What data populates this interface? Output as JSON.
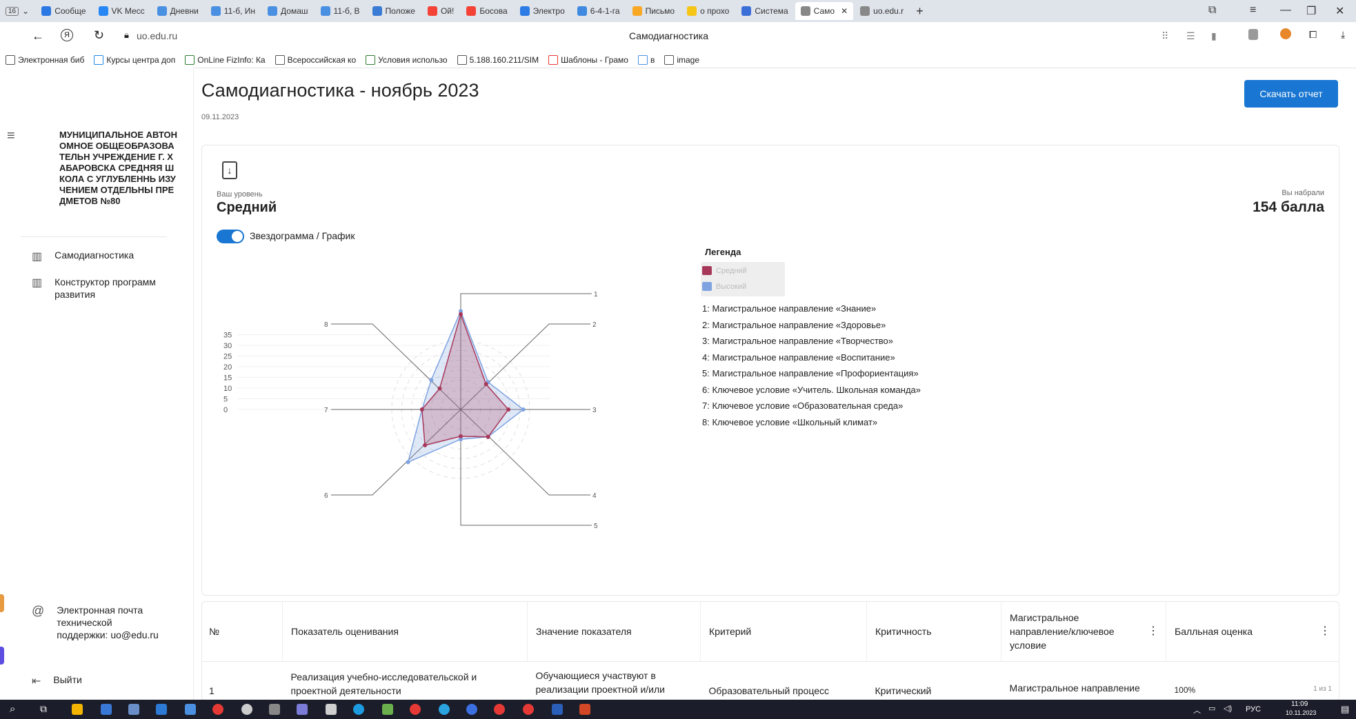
{
  "browser": {
    "tab_count": "16",
    "tabs": [
      {
        "label": "Сообще",
        "color": "#2b78e4"
      },
      {
        "label": "VK Месс",
        "color": "#2787f5"
      },
      {
        "label": "Дневни",
        "color": "#4a90e2"
      },
      {
        "label": "11-б, Ин",
        "color": "#4a90e2"
      },
      {
        "label": "Домаш",
        "color": "#4a90e2"
      },
      {
        "label": "11-б, В",
        "color": "#4a90e2"
      },
      {
        "label": "Положе",
        "color": "#3a7bd5"
      },
      {
        "label": "Ой!",
        "color": "#f44336"
      },
      {
        "label": "Босова",
        "color": "#f44336"
      },
      {
        "label": "Электро",
        "color": "#2d7be5"
      },
      {
        "label": "6-4-1-га",
        "color": "#3f8ae0"
      },
      {
        "label": "Письмо",
        "color": "#f9a825"
      },
      {
        "label": "о прохо",
        "color": "#f5c518"
      },
      {
        "label": "Система",
        "color": "#3a6fd8"
      },
      {
        "label": "Само",
        "color": "#888888",
        "active": true
      },
      {
        "label": "uo.edu.r",
        "color": "#888888"
      }
    ],
    "new_tab": "+",
    "url": "uo.edu.ru",
    "page_title": "Самодиагностика",
    "bookmarks": [
      {
        "label": "Электронная биб",
        "color": "#555555"
      },
      {
        "label": "Курсы центра доп",
        "color": "#1e88e5"
      },
      {
        "label": "OnLine FizInfo: Ка",
        "color": "#2e7d32"
      },
      {
        "label": "Всероссийская ко",
        "color": "#555555"
      },
      {
        "label": "Условия использо",
        "color": "#2e7d32"
      },
      {
        "label": "5.188.160.211/SIM",
        "color": "#555555"
      },
      {
        "label": "Шаблоны - Грамо",
        "color": "#e53935"
      },
      {
        "label": "в",
        "color": "#4a90e2"
      },
      {
        "label": "image",
        "color": "#555555"
      }
    ]
  },
  "sidebar": {
    "org_name": "МУНИЦИПАЛЬНОЕ АВТОНОМНОЕ ОБЩЕОБРАЗОВАТЕЛЬН УЧРЕЖДЕНИЕ Г. ХАБАРОВСКА СРЕДНЯЯ ШКОЛА С УГЛУБЛЕННЬ ИЗУЧЕНИЕМ ОТДЕЛЬНЫ ПРЕДМЕТОВ №80",
    "items": [
      {
        "label": "Самодиагностика"
      },
      {
        "label": "Конструктор программ развития"
      }
    ],
    "support": "Электронная почта технической поддержки: uo@edu.ru",
    "logout": "Выйти"
  },
  "header": {
    "title": "Самодиагностика - ноябрь 2023",
    "date": "09.11.2023",
    "download_button": "Скачать отчет"
  },
  "summary": {
    "level_caption": "Ваш уровень",
    "level": "Средний",
    "score_caption": "Вы набрали",
    "score": "154 балла",
    "toggle_label": "Звездограмма / График",
    "toggle_on": true
  },
  "legend": {
    "title": "Легенда",
    "series": [
      {
        "name": "Средний",
        "color": "#a8385a"
      },
      {
        "name": "Высокий",
        "color": "#7ea3e0"
      }
    ],
    "items": [
      "1: Магистральное направление «Знание»",
      "2: Магистральное направление «Здоровье»",
      "3: Магистральное направление «Творчество»",
      "4: Магистральное направление «Воспитание»",
      "5: Магистральное направление «Профориентация»",
      "6: Ключевое условие «Учитель. Школьная команда»",
      "7: Ключевое условие «Образовательная среда»",
      "8: Ключевое условие «Школьный климат»"
    ]
  },
  "chart_data": {
    "type": "radar",
    "categories": [
      "1",
      "2",
      "3",
      "4",
      "5",
      "6",
      "7",
      "8"
    ],
    "ticks": [
      "35",
      "30",
      "25",
      "20",
      "15",
      "10",
      "5",
      "0"
    ],
    "rmax": 35,
    "series": [
      {
        "name": "Средний",
        "color": "#a8385a",
        "values": [
          32,
          12,
          16,
          13,
          9,
          17,
          13,
          10
        ]
      },
      {
        "name": "Высокий",
        "color": "#7ea3e0",
        "values": [
          33,
          13,
          21,
          13,
          10,
          25,
          13,
          14
        ]
      }
    ]
  },
  "table": {
    "columns": [
      "№",
      "Показатель оценивания",
      "Значение показателя",
      "Критерий",
      "Критичность",
      "Магистральное направление/ключевое условие",
      "Балльная оценка"
    ],
    "rows": [
      [
        "1",
        "Реализация учебно-исследовательской и проектной деятельности",
        "Обучающиеся участвуют в реализации проектной и/или",
        "Образовательный процесс",
        "Критический",
        "Магистральное направление",
        "100%"
      ]
    ],
    "pagination": "1 из 1"
  },
  "taskbar": {
    "lang": "РУС",
    "time": "11:09",
    "date": "10.11.2023"
  }
}
